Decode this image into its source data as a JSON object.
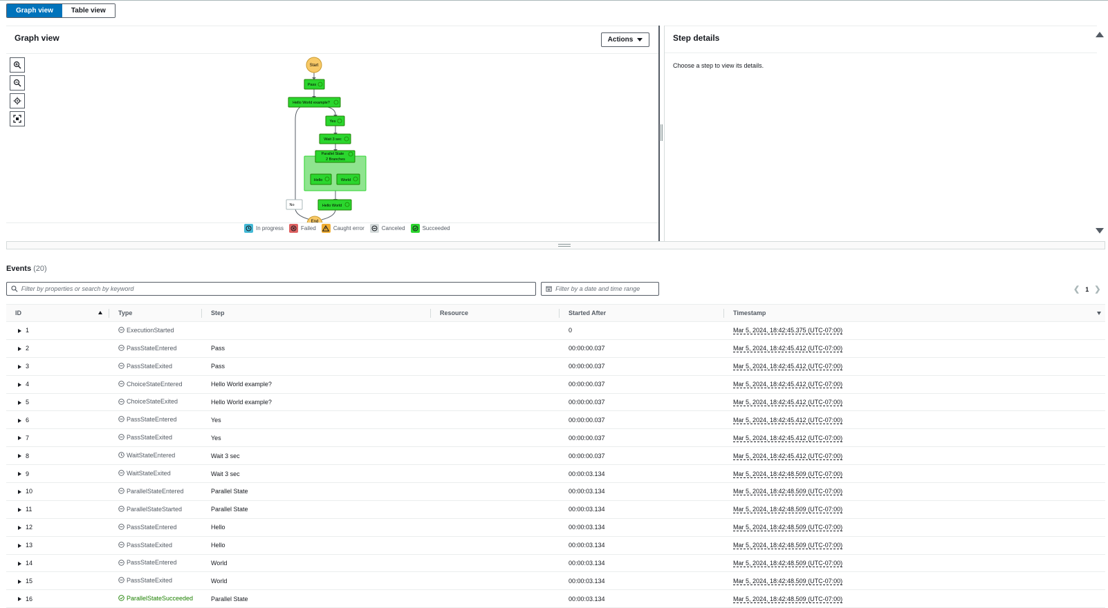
{
  "view_tabs": [
    {
      "label": "Graph view",
      "active": true
    },
    {
      "label": "Table view",
      "active": false
    }
  ],
  "graph_panel": {
    "title": "Graph view",
    "actions_label": "Actions",
    "zoom_controls": [
      "zoom-in-icon",
      "zoom-out-icon",
      "center-icon",
      "fit-icon"
    ],
    "nodes": {
      "start": "Start",
      "pass": "Pass",
      "choice": "Hello World example?",
      "yes": "Yes",
      "wait": "Wait 3 sec",
      "parallel_line1": "Parallel State",
      "parallel_line2": "2 Branches",
      "hello": "Hello",
      "world": "World",
      "no": "No",
      "hello_world": "Hello World",
      "end": "End"
    },
    "legend": [
      {
        "label": "In progress",
        "color": "#44b9d6"
      },
      {
        "label": "Failed",
        "color": "#de6262"
      },
      {
        "label": "Caught error",
        "color": "#f0ad30"
      },
      {
        "label": "Canceled",
        "color": "#d5dbdb"
      },
      {
        "label": "Succeeded",
        "color": "#2bd62e"
      }
    ]
  },
  "step_panel": {
    "title": "Step details",
    "body": "Choose a step to view its details."
  },
  "events": {
    "title": "Events",
    "count": "(20)",
    "search_placeholder": "Filter by properties or search by keyword",
    "date_placeholder": "Filter by a date and time range",
    "page": "1",
    "columns": [
      "ID",
      "Type",
      "Step",
      "Resource",
      "Started After",
      "Timestamp"
    ],
    "rows": [
      {
        "id": "1",
        "type": "ExecutionStarted",
        "step": "",
        "resource": "",
        "started_after": "0",
        "timestamp": "Mar 5, 2024, 18:42:45.375 (UTC-07:00)",
        "status": "neutral"
      },
      {
        "id": "2",
        "type": "PassStateEntered",
        "step": "Pass",
        "resource": "",
        "started_after": "00:00:00.037",
        "timestamp": "Mar 5, 2024, 18:42:45.412 (UTC-07:00)",
        "status": "neutral"
      },
      {
        "id": "3",
        "type": "PassStateExited",
        "step": "Pass",
        "resource": "",
        "started_after": "00:00:00.037",
        "timestamp": "Mar 5, 2024, 18:42:45.412 (UTC-07:00)",
        "status": "neutral"
      },
      {
        "id": "4",
        "type": "ChoiceStateEntered",
        "step": "Hello World example?",
        "resource": "",
        "started_after": "00:00:00.037",
        "timestamp": "Mar 5, 2024, 18:42:45.412 (UTC-07:00)",
        "status": "neutral"
      },
      {
        "id": "5",
        "type": "ChoiceStateExited",
        "step": "Hello World example?",
        "resource": "",
        "started_after": "00:00:00.037",
        "timestamp": "Mar 5, 2024, 18:42:45.412 (UTC-07:00)",
        "status": "neutral"
      },
      {
        "id": "6",
        "type": "PassStateEntered",
        "step": "Yes",
        "resource": "",
        "started_after": "00:00:00.037",
        "timestamp": "Mar 5, 2024, 18:42:45.412 (UTC-07:00)",
        "status": "neutral"
      },
      {
        "id": "7",
        "type": "PassStateExited",
        "step": "Yes",
        "resource": "",
        "started_after": "00:00:00.037",
        "timestamp": "Mar 5, 2024, 18:42:45.412 (UTC-07:00)",
        "status": "neutral"
      },
      {
        "id": "8",
        "type": "WaitStateEntered",
        "step": "Wait 3 sec",
        "resource": "",
        "started_after": "00:00:00.037",
        "timestamp": "Mar 5, 2024, 18:42:45.412 (UTC-07:00)",
        "status": "clock"
      },
      {
        "id": "9",
        "type": "WaitStateExited",
        "step": "Wait 3 sec",
        "resource": "",
        "started_after": "00:00:03.134",
        "timestamp": "Mar 5, 2024, 18:42:48.509 (UTC-07:00)",
        "status": "neutral"
      },
      {
        "id": "10",
        "type": "ParallelStateEntered",
        "step": "Parallel State",
        "resource": "",
        "started_after": "00:00:03.134",
        "timestamp": "Mar 5, 2024, 18:42:48.509 (UTC-07:00)",
        "status": "neutral"
      },
      {
        "id": "11",
        "type": "ParallelStateStarted",
        "step": "Parallel State",
        "resource": "",
        "started_after": "00:00:03.134",
        "timestamp": "Mar 5, 2024, 18:42:48.509 (UTC-07:00)",
        "status": "neutral"
      },
      {
        "id": "12",
        "type": "PassStateEntered",
        "step": "Hello",
        "resource": "",
        "started_after": "00:00:03.134",
        "timestamp": "Mar 5, 2024, 18:42:48.509 (UTC-07:00)",
        "status": "neutral"
      },
      {
        "id": "13",
        "type": "PassStateExited",
        "step": "Hello",
        "resource": "",
        "started_after": "00:00:03.134",
        "timestamp": "Mar 5, 2024, 18:42:48.509 (UTC-07:00)",
        "status": "neutral"
      },
      {
        "id": "14",
        "type": "PassStateEntered",
        "step": "World",
        "resource": "",
        "started_after": "00:00:03.134",
        "timestamp": "Mar 5, 2024, 18:42:48.509 (UTC-07:00)",
        "status": "neutral"
      },
      {
        "id": "15",
        "type": "PassStateExited",
        "step": "World",
        "resource": "",
        "started_after": "00:00:03.134",
        "timestamp": "Mar 5, 2024, 18:42:48.509 (UTC-07:00)",
        "status": "neutral"
      },
      {
        "id": "16",
        "type": "ParallelStateSucceeded",
        "step": "Parallel State",
        "resource": "",
        "started_after": "00:00:03.134",
        "timestamp": "Mar 5, 2024, 18:42:48.509 (UTC-07:00)",
        "status": "success"
      }
    ]
  },
  "colors": {
    "primary": "#0073bb",
    "success_node": "#2bd62e",
    "success_text": "#1d8102",
    "start_end_node": "#f8c967"
  }
}
